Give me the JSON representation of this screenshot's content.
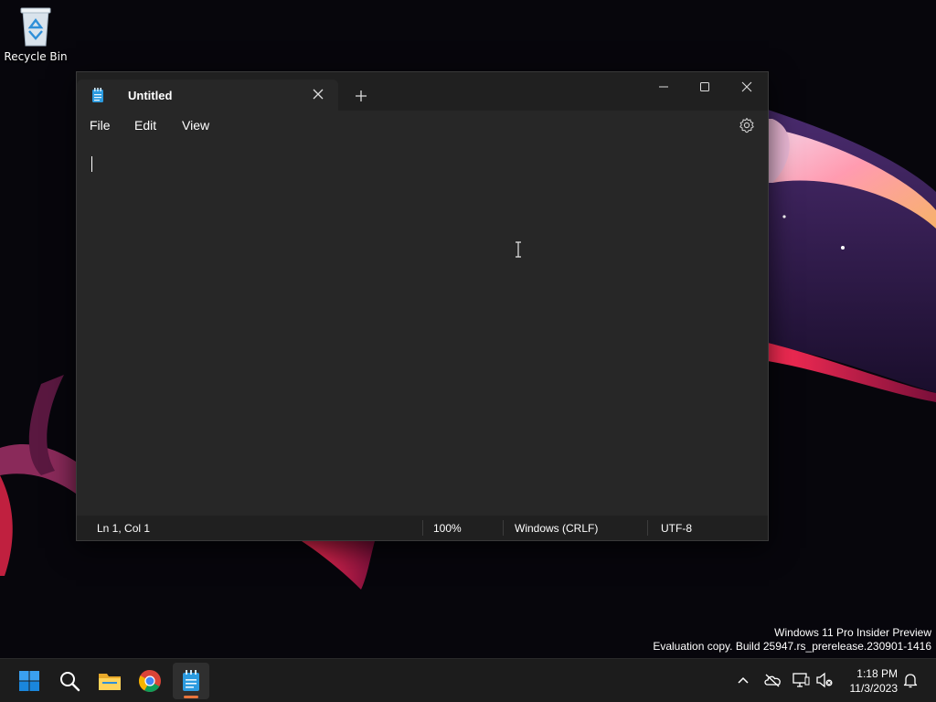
{
  "desktop": {
    "recycle_bin_label": "Recycle Bin",
    "watermark": {
      "line1": "Windows 11 Pro Insider Preview",
      "line2": "Evaluation copy. Build 25947.rs_prerelease.230901-1416"
    }
  },
  "window": {
    "app": "Notepad",
    "tab_title": "Untitled",
    "tab_icon": "notepad-icon",
    "menu": {
      "file": "File",
      "edit": "Edit",
      "view": "View"
    },
    "editor_text": "",
    "status": {
      "position": "Ln 1, Col 1",
      "zoom": "100%",
      "line_ending": "Windows (CRLF)",
      "encoding": "UTF-8"
    }
  },
  "taskbar": {
    "apps": [
      "start-icon",
      "search-icon",
      "file-explorer-icon",
      "chrome-icon",
      "notepad-icon"
    ],
    "active_app": "notepad-icon",
    "tray_icons": [
      "chevron-up-icon",
      "onedrive-icon",
      "network-icon",
      "volume-muted-icon",
      "notification-bell-icon"
    ],
    "clock": {
      "time": "1:18 PM",
      "date": "11/3/2023"
    }
  },
  "colors": {
    "window_bg": "#272727",
    "titlebar_bg": "#202020",
    "taskbar_bg": "#1c1c1c",
    "accent_windows": "#1a8fe3",
    "notepad_indicator": "#e8743c"
  }
}
